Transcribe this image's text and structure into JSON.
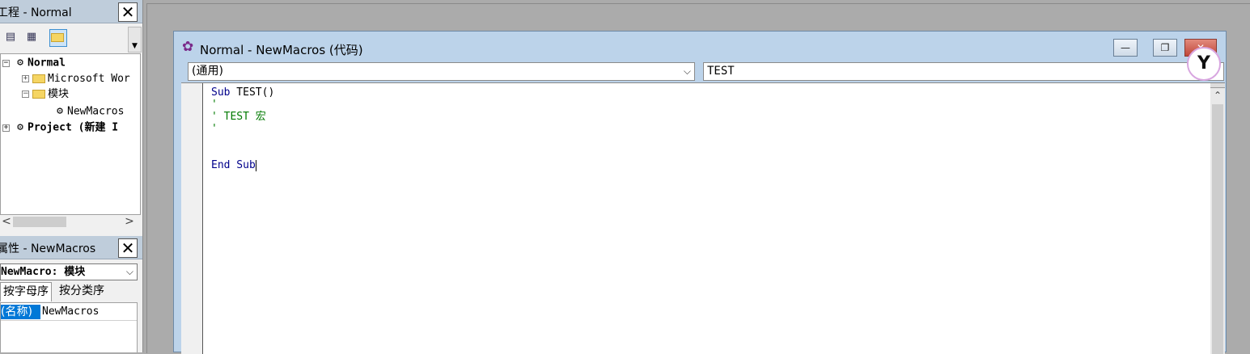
{
  "project_pane": {
    "title": "工程 - Normal",
    "close_label": "✕",
    "toolbar": {
      "view_code_icon": "▤",
      "view_object_icon": "▦",
      "toggle_folders_icon": "▭"
    },
    "tree": {
      "normal": "Normal",
      "word_objects": "Microsoft Wor",
      "modules": "模块",
      "new_macros": "NewMacros",
      "project": "Project (新建 I"
    },
    "hscroll_left": "<",
    "hscroll_right": ">"
  },
  "properties_pane": {
    "title": "属性 - NewMacros",
    "close_label": "✕",
    "object_combo": "NewMacro: 模块",
    "tabs": [
      "按字母序",
      "按分类序"
    ],
    "prop_name": "(名称)",
    "prop_value": "NewMacros"
  },
  "code_window": {
    "title": "Normal - NewMacros (代码)",
    "minimize_label": "—",
    "restore_label": "❐",
    "close_label": "✕",
    "object_combo": "(通用)",
    "procedure_combo": "TEST",
    "combo_arrow": "⌵",
    "lines": {
      "l1_kw": "Sub",
      "l1_rest": " TEST()",
      "l2": "'",
      "l3": "' TEST 宏",
      "l4": "'",
      "l5_kw": "End Sub"
    }
  }
}
